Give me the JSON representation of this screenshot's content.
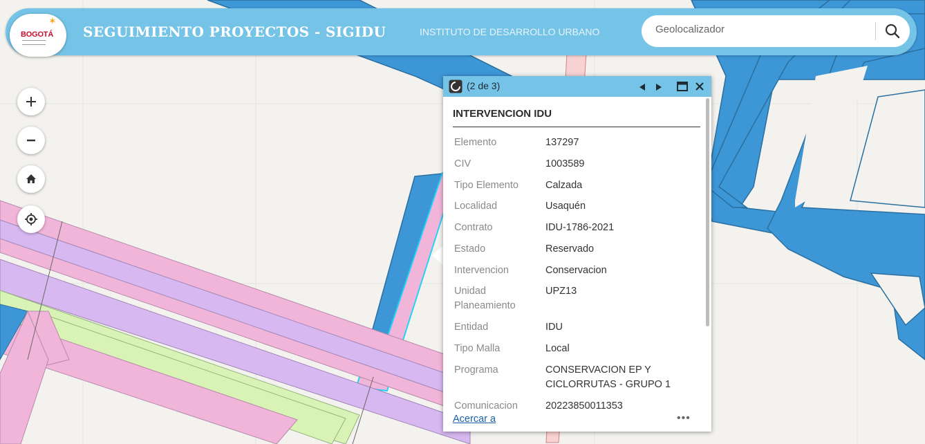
{
  "header": {
    "title": "SEGUIMIENTO PROYECTOS - SIGIDU",
    "subtitle": "INSTITUTO DE DESARROLLO URBANO",
    "logo_text": "BOGOTÁ",
    "brand_color": "#75c3e6"
  },
  "search": {
    "placeholder": "Geolocalizador",
    "icon": "search-icon"
  },
  "map_controls": [
    {
      "name": "zoom-in",
      "icon": "plus-icon"
    },
    {
      "name": "zoom-out",
      "icon": "minus-icon"
    },
    {
      "name": "home",
      "icon": "home-icon"
    },
    {
      "name": "locate",
      "icon": "locate-icon"
    }
  ],
  "popup": {
    "count": "(2 de 3)",
    "title": "INTERVENCION IDU",
    "fields": [
      {
        "label": "Elemento",
        "value": "137297"
      },
      {
        "label": "CIV",
        "value": "1003589"
      },
      {
        "label": "Tipo Elemento",
        "value": "Calzada"
      },
      {
        "label": "Localidad",
        "value": "Usaquén"
      },
      {
        "label": "Contrato",
        "value": "IDU-1786-2021"
      },
      {
        "label": "Estado",
        "value": "Reservado"
      },
      {
        "label": "Intervencion",
        "value": "Conservacion"
      },
      {
        "label": "Unidad Planeamiento",
        "value": "UPZ13"
      },
      {
        "label": "Entidad",
        "value": "IDU"
      },
      {
        "label": "Tipo Malla",
        "value": "Local"
      },
      {
        "label": "Programa",
        "value": "CONSERVACION EP Y CICLORRUTAS - GRUPO 1"
      },
      {
        "label": "Comunicacion",
        "value": "20223850011353"
      }
    ],
    "zoom_link": "Acercar a",
    "more": "•••"
  },
  "colors": {
    "road_blue": "#3d96d6",
    "road_pink": "#f2b5da",
    "road_purple": "#d8b8f0",
    "road_green": "#d8f3b5",
    "highlight": "#25d2f5"
  }
}
